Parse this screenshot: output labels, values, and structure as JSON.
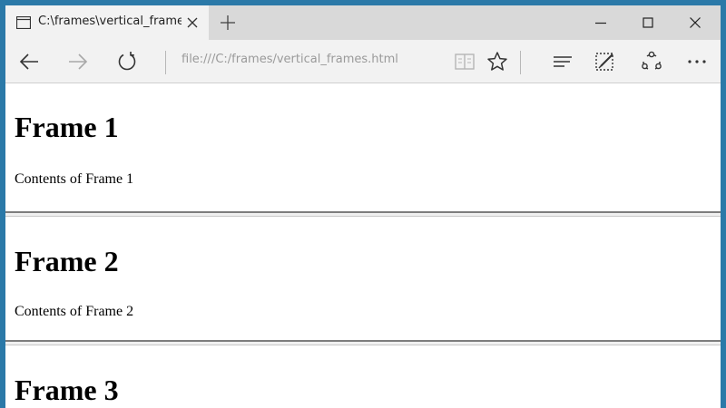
{
  "tab": {
    "title": "C:\\frames\\vertical_frame"
  },
  "address_bar": {
    "url": "file:///C:/frames/vertical_frames.html"
  },
  "icons": {
    "tab": "page-icon",
    "tab_close": "close-icon",
    "new_tab": "plus-icon",
    "minimize": "minimize-icon",
    "maximize": "maximize-icon",
    "close": "close-icon",
    "back": "back-arrow-icon",
    "forward": "forward-arrow-icon",
    "refresh": "refresh-icon",
    "reading_view": "book-icon",
    "favorite": "star-icon",
    "hub": "hub-icon",
    "web_note": "pen-note-icon",
    "share": "share-icon",
    "more": "ellipsis-icon"
  },
  "frames": [
    {
      "heading": "Frame 1",
      "body": "Contents of Frame 1"
    },
    {
      "heading": "Frame 2",
      "body": "Contents of Frame 2"
    },
    {
      "heading": "Frame 3"
    }
  ],
  "colors": {
    "desktop": "#2b79a8",
    "chrome": "#f2f2f2",
    "titlebar": "#d9d9d9",
    "address_text": "#9a9a9a",
    "disabled_icon": "#a8a8a8"
  }
}
